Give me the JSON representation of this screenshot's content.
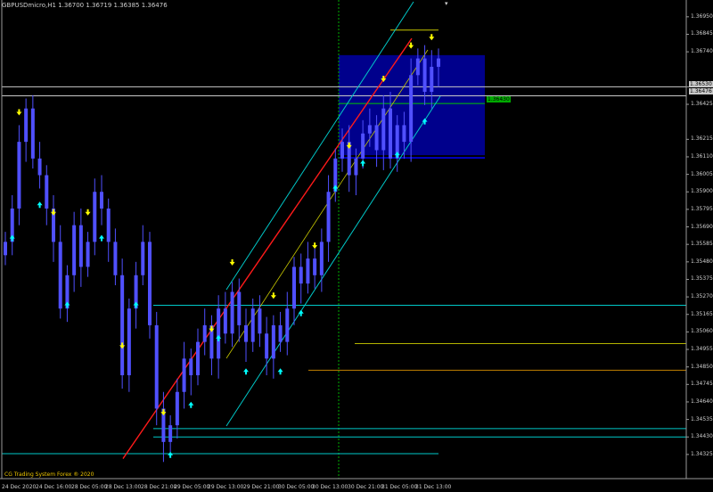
{
  "window": {
    "symbol_info": "GBPUSDmicro,H1  1.36700 1.36719 1.36385 1.36476",
    "credit": "CG Trading System Forex ® 2020",
    "top_marker": "▾"
  },
  "price_axis": {
    "range": [
      1.3418,
      1.3704
    ],
    "ticks": [
      "1.36950",
      "1.36845",
      "1.36740",
      "1.36530",
      "1.36425",
      "1.36215",
      "1.36110",
      "1.36005",
      "1.35900",
      "1.35795",
      "1.35690",
      "1.35585",
      "1.35480",
      "1.35375",
      "1.35270",
      "1.35165",
      "1.35060",
      "1.34955",
      "1.34850",
      "1.34745",
      "1.34640",
      "1.34535",
      "1.34430",
      "1.34325"
    ],
    "labels": [
      {
        "text": "1.36530",
        "bg": "#c8c8c8",
        "fg": "#000000"
      },
      {
        "text": "1.36476",
        "bg": "#c8c8c8",
        "fg": "#000000"
      }
    ]
  },
  "time_axis": {
    "ticks": [
      "24 Dec 2020",
      "24 Dec 16:00",
      "28 Dec 05:00",
      "28 Dec 13:00",
      "28 Dec 21:00",
      "29 Dec 05:00",
      "29 Dec 13:00",
      "29 Dec 21:00",
      "30 Dec 05:00",
      "30 Dec 13:00",
      "30 Dec 21:00",
      "31 Dec 05:00",
      "31 Dec 13:00"
    ]
  },
  "zone": {
    "price_label": "1.36430",
    "fill": "#00008c",
    "label_bg": "#00aa00",
    "label_fg": "#000000"
  },
  "colors": {
    "background": "#000000",
    "candle": "#5050ff",
    "regression": "#ff1a1a",
    "channel": "#00c8c8",
    "channel_mid": "#c8c800",
    "up_arrow": "#00ffff",
    "down_arrow": "#ffff00",
    "vline": "#00b000",
    "hline_cyan": "#00c8c8",
    "hline_yellow": "#b4b400",
    "hline_orange": "#c08000"
  },
  "chart_data": {
    "type": "candlestick",
    "symbol": "GBPUSDmicro",
    "timeframe": "H1",
    "last_bar": {
      "open": 1.367,
      "high": 1.36719,
      "low": 1.36385,
      "close": 1.36476
    },
    "close_series": [
      1.356,
      1.358,
      1.362,
      1.364,
      1.361,
      1.36,
      1.358,
      1.356,
      1.352,
      1.354,
      1.357,
      1.3545,
      1.356,
      1.359,
      1.358,
      1.356,
      1.354,
      1.348,
      1.352,
      1.354,
      1.356,
      1.351,
      1.346,
      1.344,
      1.345,
      1.347,
      1.349,
      1.348,
      1.35,
      1.351,
      1.349,
      1.352,
      1.3505,
      1.353,
      1.351,
      1.35,
      1.352,
      1.3505,
      1.349,
      1.351,
      1.35,
      1.352,
      1.3545,
      1.3535,
      1.355,
      1.354,
      1.356,
      1.359,
      1.361,
      1.362,
      1.36,
      1.361,
      1.3625,
      1.363,
      1.3615,
      1.364,
      1.361,
      1.363,
      1.362,
      1.366,
      1.367,
      1.365,
      1.3665,
      1.367
    ],
    "horizontal_levels": [
      1.3653,
      1.36476,
      1.3522,
      1.3499,
      1.3483,
      1.3448,
      1.3443,
      1.3433
    ],
    "regression_line": {
      "from": 1.343,
      "to": 1.3682
    },
    "zone": {
      "top": 1.3672,
      "bottom": 1.3612,
      "label": "1.36430"
    }
  }
}
